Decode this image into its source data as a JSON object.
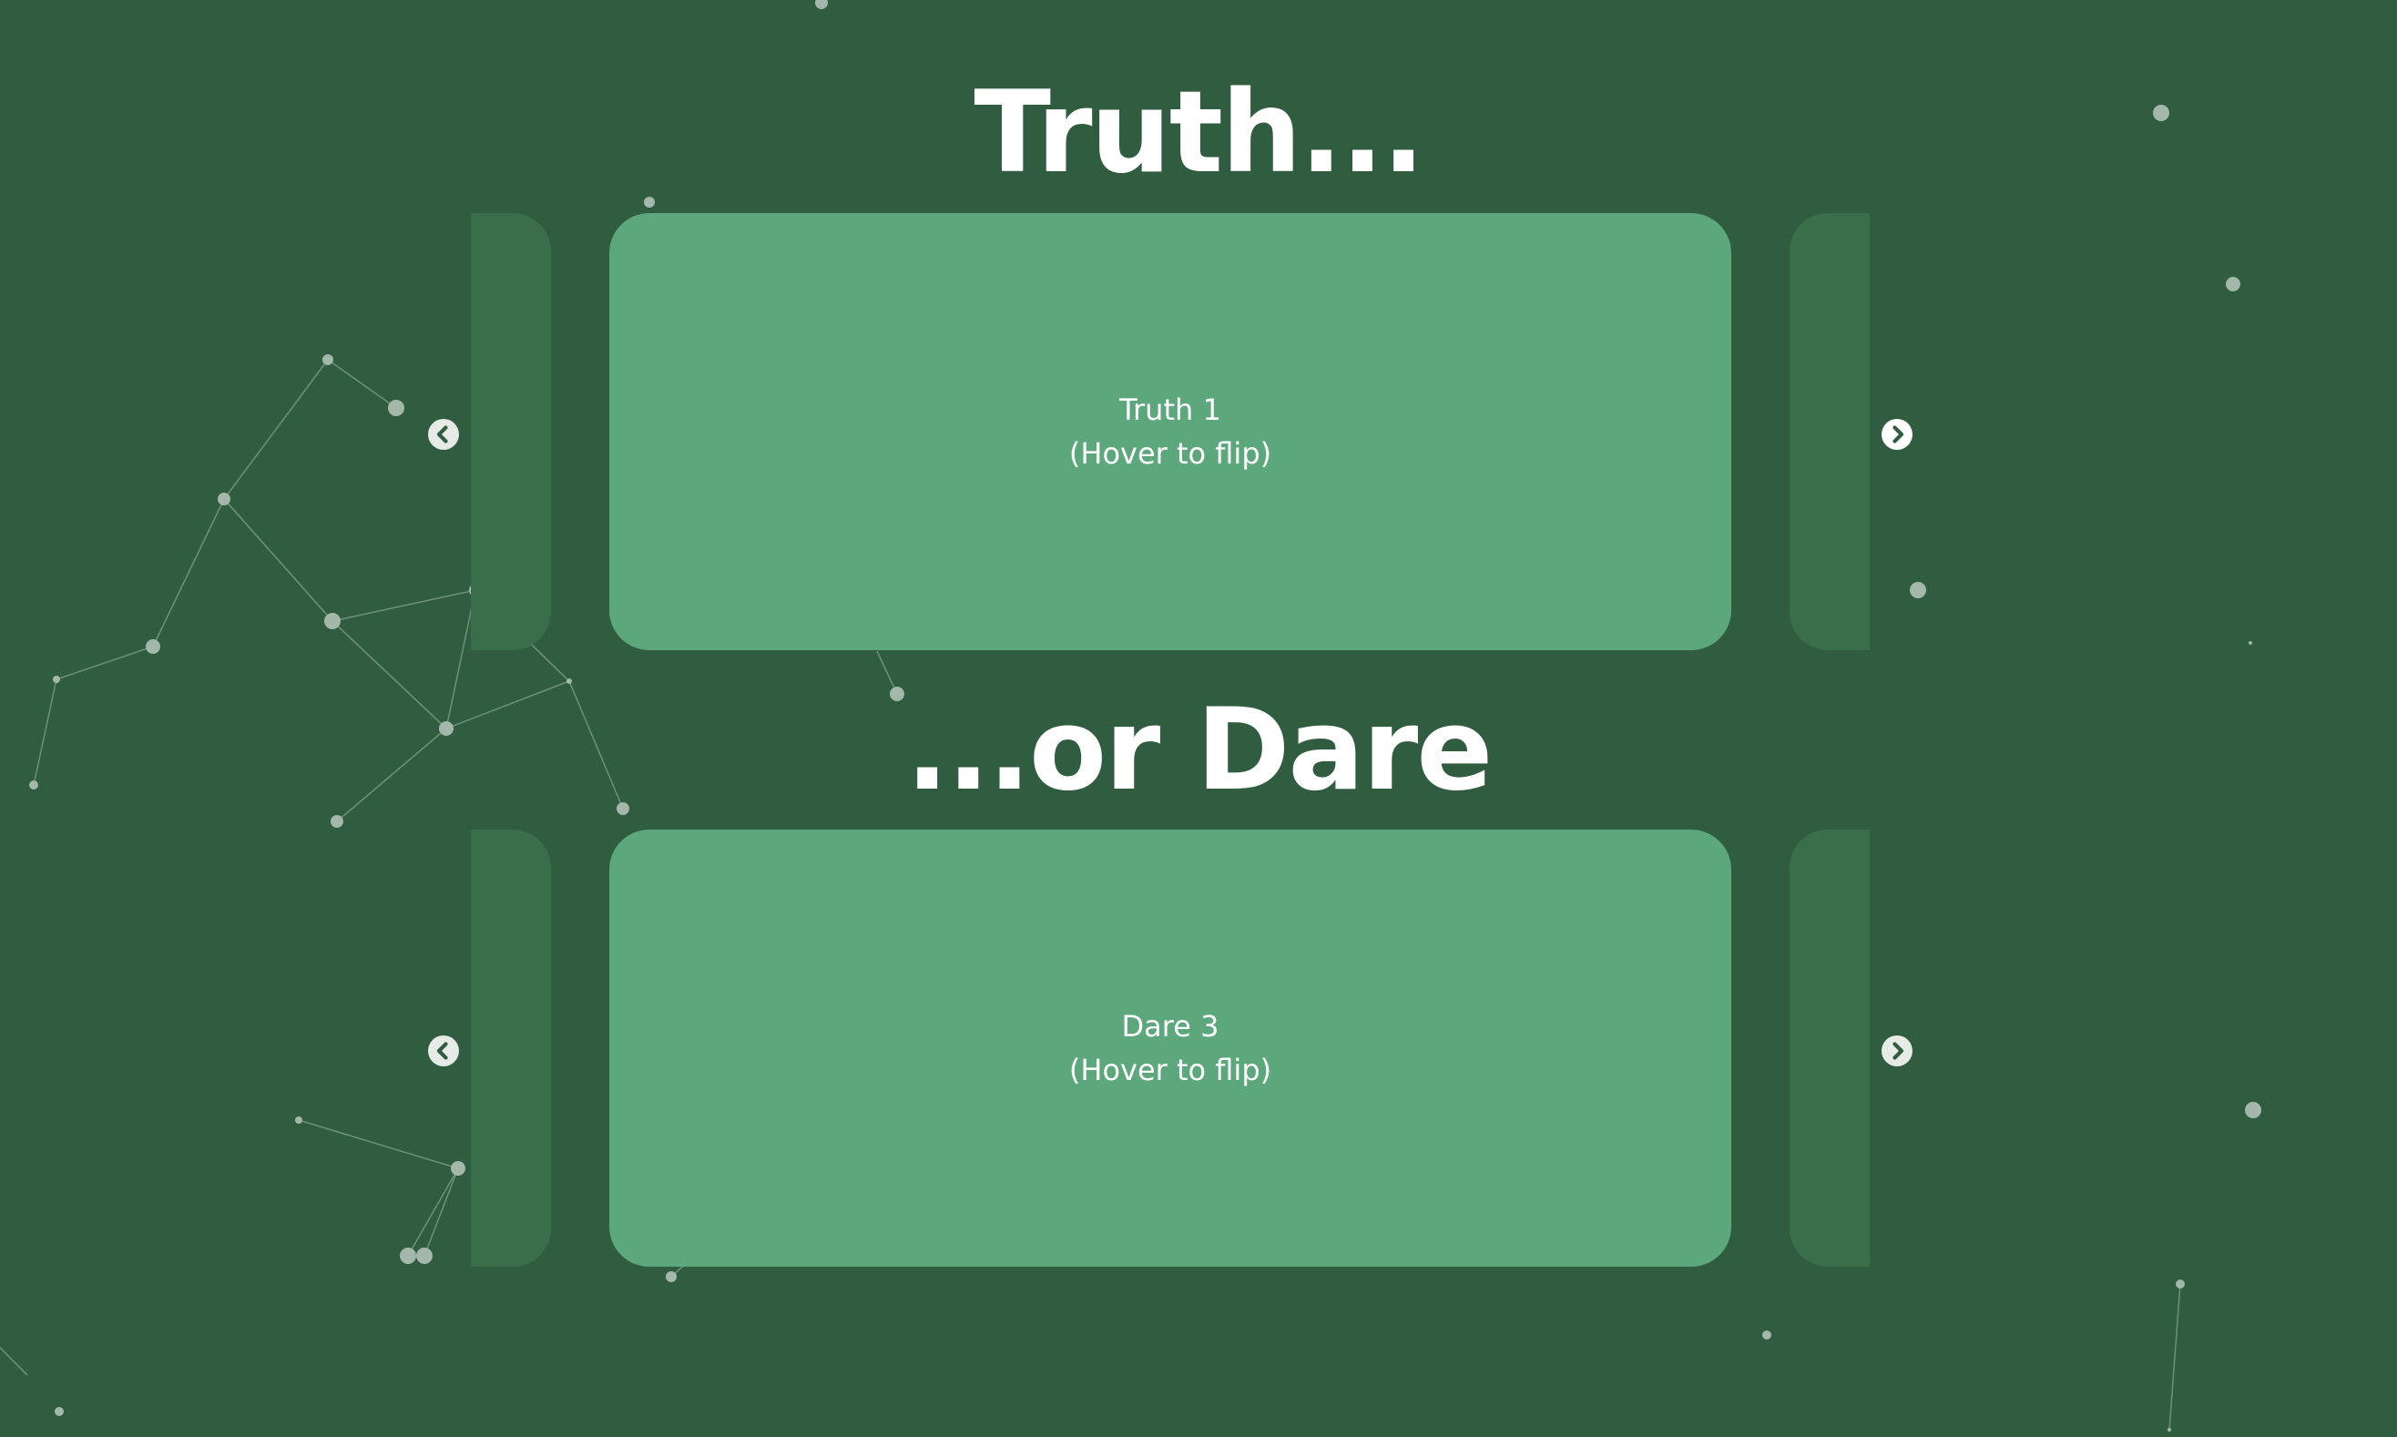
{
  "headings": {
    "truth": "Truth...",
    "dare": "...or Dare"
  },
  "truth_card": {
    "title": "Truth 1",
    "hint": "(Hover to flip)"
  },
  "dare_card": {
    "title": "Dare 3",
    "hint": "(Hover to flip)"
  },
  "icons": {
    "prev": "chevron-left-circle-icon",
    "next": "chevron-right-circle-icon"
  },
  "colors": {
    "background": "#305c3f",
    "card": "#5ca87c",
    "side_card": "#3a6e4b",
    "text": "#ffffff",
    "particle": "#a3b8ab"
  }
}
